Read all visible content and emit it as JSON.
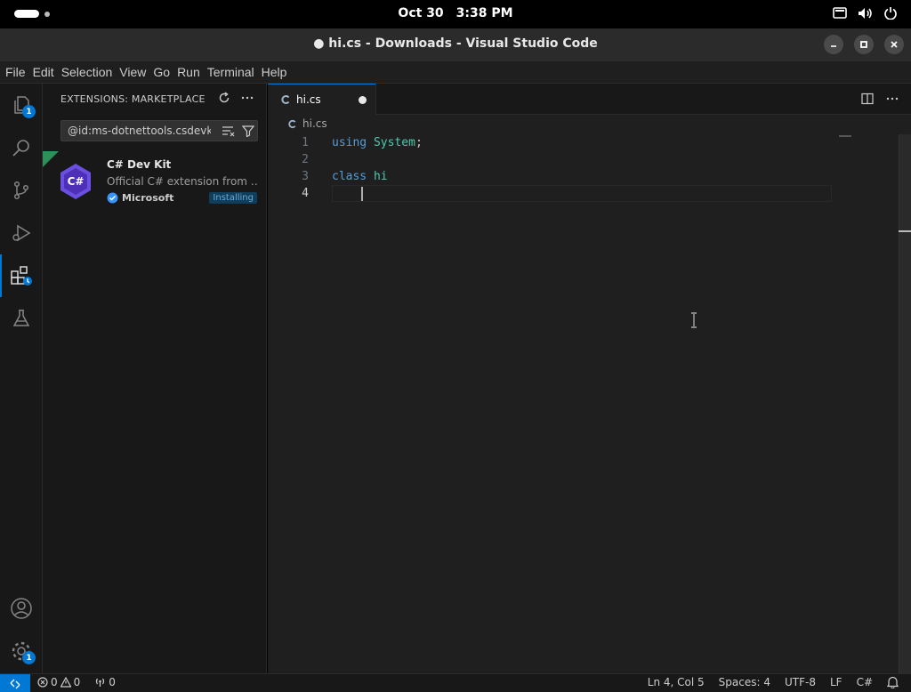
{
  "system": {
    "date": "Oct 30",
    "time": "3:38 PM"
  },
  "window": {
    "title": "● hi.cs - Downloads - Visual Studio Code"
  },
  "menu": [
    "File",
    "Edit",
    "Selection",
    "View",
    "Go",
    "Run",
    "Terminal",
    "Help"
  ],
  "activity_bar": {
    "explorer_badge": "1",
    "settings_badge": "1"
  },
  "sidebar": {
    "title": "EXTENSIONS: MARKETPLACE",
    "search_value": "@id:ms-dotnettools.csdevkit",
    "extension": {
      "logo_text": "C#",
      "name": "C# Dev Kit",
      "description": "Official C# extension from …",
      "publisher": "Microsoft",
      "status": "Installing"
    }
  },
  "editor": {
    "tab_label": "hi.cs",
    "breadcrumb": "hi.cs",
    "lines": [
      {
        "num": "1",
        "text": "using System;"
      },
      {
        "num": "2",
        "text": ""
      },
      {
        "num": "3",
        "text": "class hi"
      },
      {
        "num": "4",
        "text": "    "
      }
    ]
  },
  "status_bar": {
    "errors": "0",
    "warnings": "0",
    "ports": "0",
    "position": "Ln 4, Col 5",
    "spaces": "Spaces: 4",
    "encoding": "UTF-8",
    "eol": "LF",
    "language": "C#"
  },
  "colors": {
    "accent": "#0078d4",
    "keyword": "#569cd6",
    "type": "#4ec9b0"
  }
}
